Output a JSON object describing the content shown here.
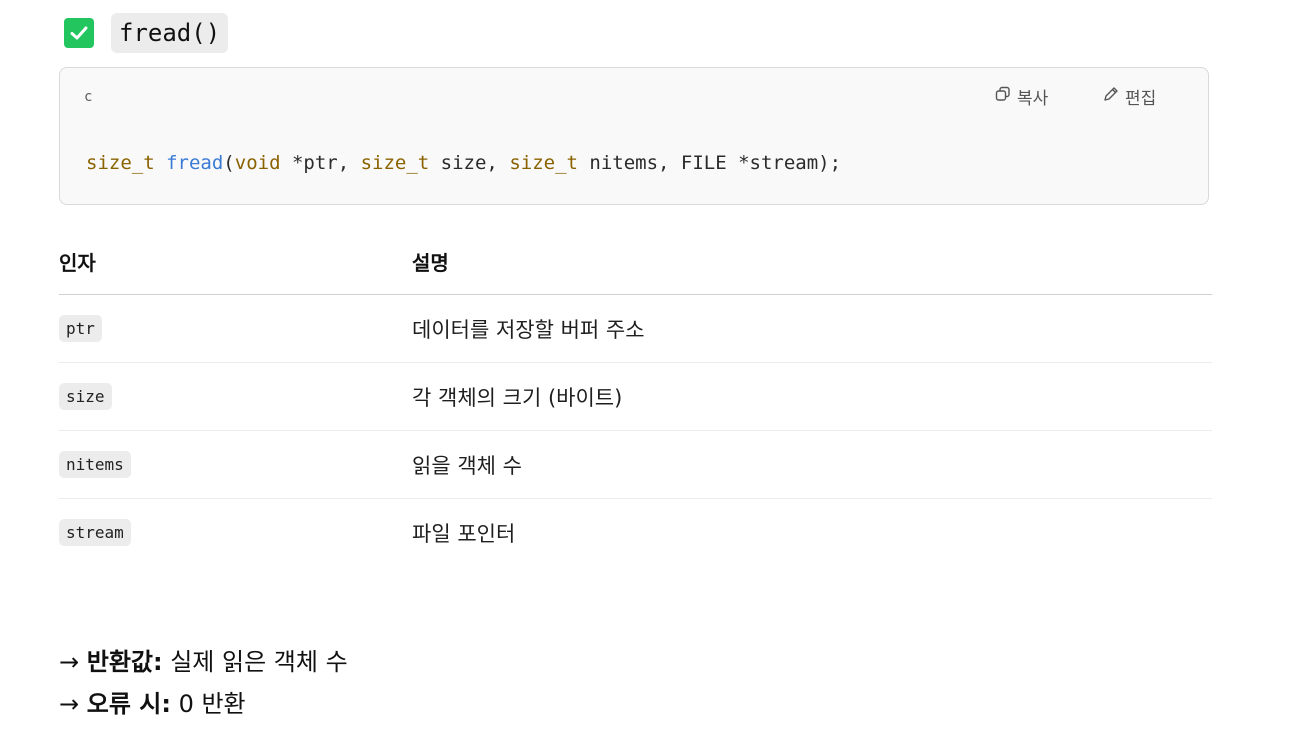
{
  "heading": {
    "function_name": "fread()"
  },
  "code": {
    "language": "c",
    "copy_label": "복사",
    "edit_label": "편집",
    "tokens": {
      "t1": "size_t",
      "s1": " ",
      "t2": "fread",
      "s2": "(",
      "t3": "void",
      "s3": " *ptr, ",
      "t4": "size_t",
      "s4": " size, ",
      "t5": "size_t",
      "s5": " nitems, FILE *stream);"
    }
  },
  "table": {
    "headers": [
      "인자",
      "설명"
    ],
    "rows": [
      {
        "arg": "ptr",
        "desc": "데이터를 저장할 버퍼 주소"
      },
      {
        "arg": "size",
        "desc": "각 객체의 크기 (바이트)"
      },
      {
        "arg": "nitems",
        "desc": "읽을 객체 수"
      },
      {
        "arg": "stream",
        "desc": "파일 포인터"
      }
    ]
  },
  "notes": [
    {
      "arrow": "→ ",
      "label": "반환값:",
      "text": " 실제 읽은 객체 수"
    },
    {
      "arrow": "→ ",
      "label": "오류 시:",
      "text": " 0 반환"
    }
  ],
  "colors": {
    "check": "#22c55e",
    "type": "#8a6300",
    "function": "#3a7bd5"
  }
}
